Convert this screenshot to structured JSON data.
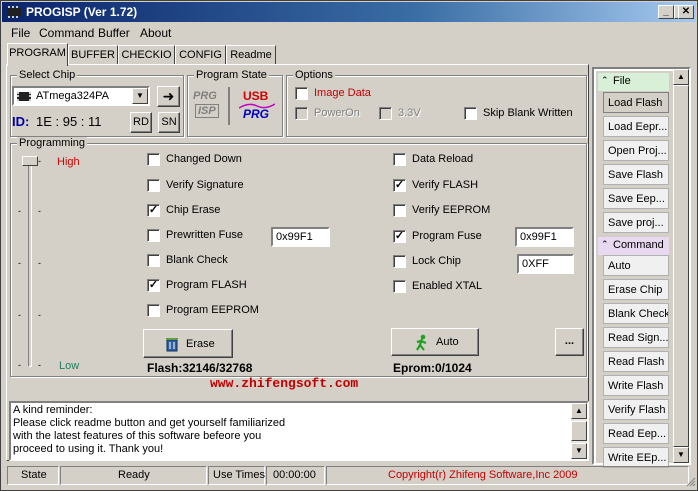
{
  "window": {
    "title": "PROGISP (Ver 1.72)"
  },
  "menu": [
    "File",
    "Command",
    "Buffer",
    "About"
  ],
  "tabs": [
    "PROGRAM",
    "BUFFER",
    "CHECKIO",
    "CONFIG",
    "Readme"
  ],
  "select_chip": {
    "label": "Select Chip",
    "chip": "ATmega324PA",
    "id_label": "ID:",
    "id_value": "1E : 95 : 11",
    "rd_label": "RD",
    "sn_label": "SN"
  },
  "program_state": {
    "label": "Program State",
    "logo_left_top": "PRG",
    "logo_left_bottom": "ISP",
    "logo_right_top": "USB",
    "logo_right_bottom": "PRG"
  },
  "options": {
    "label": "Options",
    "image_data": "Image Data",
    "power_on": "PowerOn",
    "v33": "3.3V",
    "skip_blank": "Skip Blank Written"
  },
  "programming": {
    "label": "Programming",
    "high": "High",
    "low": "Low",
    "left_checks": [
      {
        "label": "Changed Down",
        "checked": false
      },
      {
        "label": "Verify Signature",
        "checked": false
      },
      {
        "label": "Chip Erase",
        "checked": true
      },
      {
        "label": "Prewritten Fuse",
        "checked": false
      },
      {
        "label": "Blank Check",
        "checked": false
      },
      {
        "label": "Program FLASH",
        "checked": true
      },
      {
        "label": "Program EEPROM",
        "checked": false
      }
    ],
    "right_checks": [
      {
        "label": "Data Reload",
        "checked": false
      },
      {
        "label": "Verify FLASH",
        "checked": true
      },
      {
        "label": "Verify EEPROM",
        "checked": false
      },
      {
        "label": "Program Fuse",
        "checked": true
      },
      {
        "label": "Lock Chip",
        "checked": false
      },
      {
        "label": "Enabled XTAL",
        "checked": false
      }
    ],
    "prewritten_fuse_value": "0x99F1",
    "program_fuse_value": "0x99F1",
    "lock_chip_value": "0XFF",
    "erase_label": "Erase",
    "auto_label": "Auto",
    "more_label": "...",
    "flash_info": "Flash:32146/32768",
    "eprom_info": "Eprom:0/1024",
    "website": "www.zhifengsoft.com"
  },
  "memo": {
    "text": "A kind reminder:\nPlease click readme button and get yourself familiarized\nwith the latest features of this software befeore you\nproceed to using it. Thank you!"
  },
  "sidebar": {
    "file_header": "File",
    "file_items": [
      "Load Flash",
      "Load Eepr...",
      "Open Proj...",
      "Save Flash",
      "Save Eep...",
      "Save proj..."
    ],
    "command_header": "Command",
    "command_items": [
      "Auto",
      "Erase Chip",
      "Blank Check",
      "Read Sign...",
      "Read Flash",
      "Write Flash",
      "Verify Flash",
      "Read Eep...",
      "Write EEp..."
    ]
  },
  "statusbar": {
    "state_label": "State",
    "state_value": "Ready",
    "use_times_label": "Use Times",
    "use_times_value": "00:00:00",
    "copyright": "Copyright(r) Zhifeng Software,Inc 2009"
  },
  "colors": {
    "high": "#d00000",
    "low": "#208060",
    "image_data": "#c00000",
    "website": "#c00000",
    "copyright": "#c00000",
    "id_blue": "#0000a0"
  }
}
